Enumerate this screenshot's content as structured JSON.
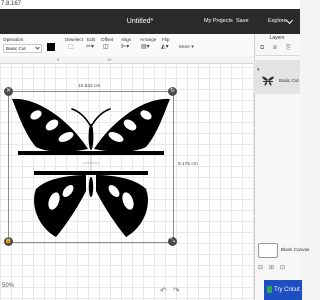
{
  "window": {
    "address": "7.8.167"
  },
  "header": {
    "title": "Untitled*",
    "my_projects": "My Projects",
    "save": "Save",
    "explore": "Explore"
  },
  "toolbar": {
    "operation_label": "Operation",
    "operation_value": "Basic Cut",
    "deselect": "Deselect",
    "edit": "Edit",
    "offset": "Offset",
    "align": "Align",
    "arrange": "Arrange",
    "flip": "Flip",
    "more": "More ▾"
  },
  "canvas": {
    "ruler_ticks": [
      "9",
      "10"
    ],
    "width_label": "10.842 cm",
    "height_label": "9.175 cm",
    "zoom": "50%",
    "artwork_color": "#000000"
  },
  "layers": {
    "title": "Layers",
    "item_name": "Basic Cut",
    "blank_canvas_label": "Blank Canvas"
  },
  "cta": {
    "label": "Try Cricut"
  }
}
